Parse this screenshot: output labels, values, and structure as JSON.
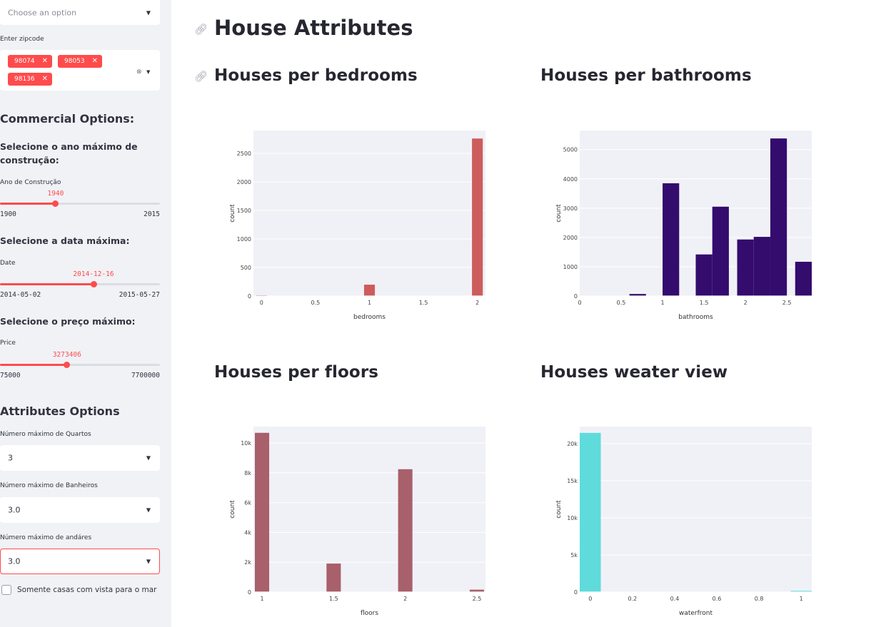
{
  "sidebar": {
    "top_select": {
      "placeholder": "Choose an option"
    },
    "zipcode": {
      "label": "Enter zipcode",
      "chips": [
        "98074",
        "98053",
        "98136"
      ]
    },
    "commercial": {
      "heading": "Commercial Options:",
      "year": {
        "heading": "Selecione o ano máximo de construção:",
        "label": "Ano de Construção",
        "value": "1940",
        "min": "1900",
        "max": "2015",
        "fraction": 0.348
      },
      "date": {
        "heading": "Selecione a data máxima:",
        "label": "Date",
        "value": "2014-12-16",
        "min": "2014-05-02",
        "max": "2015-05-27",
        "fraction": 0.585
      },
      "price": {
        "heading": "Selecione o preço máximo:",
        "label": "Price",
        "value": "3273406",
        "min": "75000",
        "max": "7700000",
        "fraction": 0.419
      }
    },
    "attributes": {
      "heading": "Attributes Options",
      "bedrooms": {
        "label": "Número máximo de Quartos",
        "value": "3"
      },
      "bathrooms": {
        "label": "Número máximo de Banheiros",
        "value": "3.0"
      },
      "floors": {
        "label": "Número máximo de andáres",
        "value": "3.0"
      },
      "waterview": {
        "label": "Somente casas com vista para o mar",
        "checked": false
      }
    }
  },
  "main": {
    "title": "House Attributes",
    "charts": {
      "bedrooms": {
        "title": "Houses per bedrooms"
      },
      "bathrooms": {
        "title": "Houses per bathrooms"
      },
      "floors": {
        "title": "Houses per floors"
      },
      "waterview": {
        "title": "Houses weater view"
      }
    }
  },
  "icons": {
    "link": "link-icon",
    "dropdown": "chevron-down-icon",
    "remove": "close-icon",
    "clear": "clear-icon"
  },
  "colors": {
    "accent": "#ff4b4b",
    "sidebar_bg": "#f0f2f6",
    "plot_bg": "#f0f1f6"
  },
  "chart_data": [
    {
      "type": "bar",
      "xlabel": "bedrooms",
      "ylabel": "count",
      "xlim": [
        -0.075,
        2.075
      ],
      "ylim": [
        0,
        2900
      ],
      "xticks": [
        0,
        0.5,
        1,
        1.5,
        2
      ],
      "xtick_labels": [
        "0",
        "0.5",
        "1",
        "1.5",
        "2"
      ],
      "yticks": [
        0,
        500,
        1000,
        1500,
        2000,
        2500
      ],
      "ytick_labels": [
        "0",
        "500",
        "1000",
        "1500",
        "2000",
        "2500"
      ],
      "bar_width": 0.1,
      "color": "#cd5c5c",
      "x": [
        0,
        1,
        2
      ],
      "values": [
        13,
        199,
        2760
      ]
    },
    {
      "type": "bar",
      "xlabel": "bathrooms",
      "ylabel": "count",
      "xlim": [
        0,
        2.8
      ],
      "ylim": [
        0,
        5650
      ],
      "xticks": [
        0,
        0.5,
        1,
        1.5,
        2,
        2.5
      ],
      "xtick_labels": [
        "0",
        "0.5",
        "1",
        "1.5",
        "2",
        "2.5"
      ],
      "yticks": [
        0,
        1000,
        2000,
        3000,
        4000,
        5000
      ],
      "ytick_labels": [
        "0",
        "1000",
        "2000",
        "3000",
        "4000",
        "5000"
      ],
      "bar_width": 0.2,
      "color": "#330c6e",
      "x": [
        0.1,
        0.5,
        0.7,
        1.1,
        1.3,
        1.5,
        1.7,
        2.0,
        2.2,
        2.4,
        2.7
      ],
      "values": [
        10,
        10,
        70,
        3850,
        10,
        1420,
        3050,
        1930,
        2020,
        5380,
        1170
      ]
    },
    {
      "type": "bar",
      "xlabel": "floors",
      "ylabel": "count",
      "xlim": [
        0.94,
        2.56
      ],
      "ylim": [
        0,
        11100
      ],
      "xticks": [
        1,
        1.5,
        2,
        2.5
      ],
      "xtick_labels": [
        "1",
        "1.5",
        "2",
        "2.5"
      ],
      "yticks": [
        0,
        2000,
        4000,
        6000,
        8000,
        10000
      ],
      "ytick_labels": [
        "0",
        "2k",
        "4k",
        "6k",
        "8k",
        "10k"
      ],
      "bar_width": 0.1,
      "color": "#a8606b",
      "x": [
        1,
        1.5,
        2,
        2.5
      ],
      "values": [
        10680,
        1910,
        8240,
        160
      ]
    },
    {
      "type": "bar",
      "xlabel": "waterfront",
      "ylabel": "count",
      "xlim": [
        -0.05,
        1.05
      ],
      "ylim": [
        0,
        22300
      ],
      "xticks": [
        0,
        0.2,
        0.4,
        0.6,
        0.8,
        1
      ],
      "xtick_labels": [
        "0",
        "0.2",
        "0.4",
        "0.6",
        "0.8",
        "1"
      ],
      "yticks": [
        0,
        5000,
        10000,
        15000,
        20000
      ],
      "ytick_labels": [
        "0",
        "5k",
        "10k",
        "15k",
        "20k"
      ],
      "bar_width": 0.1,
      "color": "#5fdbdb",
      "x": [
        0,
        1
      ],
      "values": [
        21450,
        163
      ]
    }
  ]
}
